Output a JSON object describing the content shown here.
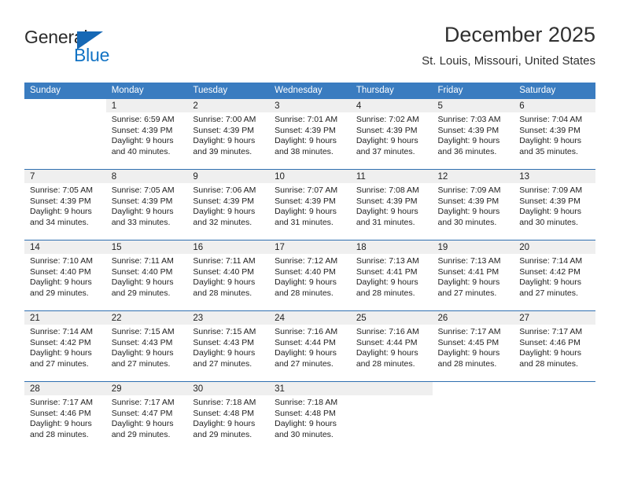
{
  "brand": {
    "name_line1": "General",
    "name_line2": "Blue",
    "accent_color": "#1668b5",
    "text_color": "#2b2b2b"
  },
  "header": {
    "title": "December 2025",
    "subtitle": "St. Louis, Missouri, United States"
  },
  "calendar": {
    "header_bg": "#3a7cc0",
    "daynum_bg": "#efefef",
    "separator_color": "#2f6fb0",
    "weekdays": [
      "Sunday",
      "Monday",
      "Tuesday",
      "Wednesday",
      "Thursday",
      "Friday",
      "Saturday"
    ],
    "weeks": [
      [
        {
          "day": "",
          "sunrise": "",
          "sunset": "",
          "daylight_line1": "",
          "daylight_line2": "",
          "blank": true
        },
        {
          "day": "1",
          "sunrise": "Sunrise: 6:59 AM",
          "sunset": "Sunset: 4:39 PM",
          "daylight_line1": "Daylight: 9 hours",
          "daylight_line2": "and 40 minutes."
        },
        {
          "day": "2",
          "sunrise": "Sunrise: 7:00 AM",
          "sunset": "Sunset: 4:39 PM",
          "daylight_line1": "Daylight: 9 hours",
          "daylight_line2": "and 39 minutes."
        },
        {
          "day": "3",
          "sunrise": "Sunrise: 7:01 AM",
          "sunset": "Sunset: 4:39 PM",
          "daylight_line1": "Daylight: 9 hours",
          "daylight_line2": "and 38 minutes."
        },
        {
          "day": "4",
          "sunrise": "Sunrise: 7:02 AM",
          "sunset": "Sunset: 4:39 PM",
          "daylight_line1": "Daylight: 9 hours",
          "daylight_line2": "and 37 minutes."
        },
        {
          "day": "5",
          "sunrise": "Sunrise: 7:03 AM",
          "sunset": "Sunset: 4:39 PM",
          "daylight_line1": "Daylight: 9 hours",
          "daylight_line2": "and 36 minutes."
        },
        {
          "day": "6",
          "sunrise": "Sunrise: 7:04 AM",
          "sunset": "Sunset: 4:39 PM",
          "daylight_line1": "Daylight: 9 hours",
          "daylight_line2": "and 35 minutes."
        }
      ],
      [
        {
          "day": "7",
          "sunrise": "Sunrise: 7:05 AM",
          "sunset": "Sunset: 4:39 PM",
          "daylight_line1": "Daylight: 9 hours",
          "daylight_line2": "and 34 minutes."
        },
        {
          "day": "8",
          "sunrise": "Sunrise: 7:05 AM",
          "sunset": "Sunset: 4:39 PM",
          "daylight_line1": "Daylight: 9 hours",
          "daylight_line2": "and 33 minutes."
        },
        {
          "day": "9",
          "sunrise": "Sunrise: 7:06 AM",
          "sunset": "Sunset: 4:39 PM",
          "daylight_line1": "Daylight: 9 hours",
          "daylight_line2": "and 32 minutes."
        },
        {
          "day": "10",
          "sunrise": "Sunrise: 7:07 AM",
          "sunset": "Sunset: 4:39 PM",
          "daylight_line1": "Daylight: 9 hours",
          "daylight_line2": "and 31 minutes."
        },
        {
          "day": "11",
          "sunrise": "Sunrise: 7:08 AM",
          "sunset": "Sunset: 4:39 PM",
          "daylight_line1": "Daylight: 9 hours",
          "daylight_line2": "and 31 minutes."
        },
        {
          "day": "12",
          "sunrise": "Sunrise: 7:09 AM",
          "sunset": "Sunset: 4:39 PM",
          "daylight_line1": "Daylight: 9 hours",
          "daylight_line2": "and 30 minutes."
        },
        {
          "day": "13",
          "sunrise": "Sunrise: 7:09 AM",
          "sunset": "Sunset: 4:39 PM",
          "daylight_line1": "Daylight: 9 hours",
          "daylight_line2": "and 30 minutes."
        }
      ],
      [
        {
          "day": "14",
          "sunrise": "Sunrise: 7:10 AM",
          "sunset": "Sunset: 4:40 PM",
          "daylight_line1": "Daylight: 9 hours",
          "daylight_line2": "and 29 minutes."
        },
        {
          "day": "15",
          "sunrise": "Sunrise: 7:11 AM",
          "sunset": "Sunset: 4:40 PM",
          "daylight_line1": "Daylight: 9 hours",
          "daylight_line2": "and 29 minutes."
        },
        {
          "day": "16",
          "sunrise": "Sunrise: 7:11 AM",
          "sunset": "Sunset: 4:40 PM",
          "daylight_line1": "Daylight: 9 hours",
          "daylight_line2": "and 28 minutes."
        },
        {
          "day": "17",
          "sunrise": "Sunrise: 7:12 AM",
          "sunset": "Sunset: 4:40 PM",
          "daylight_line1": "Daylight: 9 hours",
          "daylight_line2": "and 28 minutes."
        },
        {
          "day": "18",
          "sunrise": "Sunrise: 7:13 AM",
          "sunset": "Sunset: 4:41 PM",
          "daylight_line1": "Daylight: 9 hours",
          "daylight_line2": "and 28 minutes."
        },
        {
          "day": "19",
          "sunrise": "Sunrise: 7:13 AM",
          "sunset": "Sunset: 4:41 PM",
          "daylight_line1": "Daylight: 9 hours",
          "daylight_line2": "and 27 minutes."
        },
        {
          "day": "20",
          "sunrise": "Sunrise: 7:14 AM",
          "sunset": "Sunset: 4:42 PM",
          "daylight_line1": "Daylight: 9 hours",
          "daylight_line2": "and 27 minutes."
        }
      ],
      [
        {
          "day": "21",
          "sunrise": "Sunrise: 7:14 AM",
          "sunset": "Sunset: 4:42 PM",
          "daylight_line1": "Daylight: 9 hours",
          "daylight_line2": "and 27 minutes."
        },
        {
          "day": "22",
          "sunrise": "Sunrise: 7:15 AM",
          "sunset": "Sunset: 4:43 PM",
          "daylight_line1": "Daylight: 9 hours",
          "daylight_line2": "and 27 minutes."
        },
        {
          "day": "23",
          "sunrise": "Sunrise: 7:15 AM",
          "sunset": "Sunset: 4:43 PM",
          "daylight_line1": "Daylight: 9 hours",
          "daylight_line2": "and 27 minutes."
        },
        {
          "day": "24",
          "sunrise": "Sunrise: 7:16 AM",
          "sunset": "Sunset: 4:44 PM",
          "daylight_line1": "Daylight: 9 hours",
          "daylight_line2": "and 27 minutes."
        },
        {
          "day": "25",
          "sunrise": "Sunrise: 7:16 AM",
          "sunset": "Sunset: 4:44 PM",
          "daylight_line1": "Daylight: 9 hours",
          "daylight_line2": "and 28 minutes."
        },
        {
          "day": "26",
          "sunrise": "Sunrise: 7:17 AM",
          "sunset": "Sunset: 4:45 PM",
          "daylight_line1": "Daylight: 9 hours",
          "daylight_line2": "and 28 minutes."
        },
        {
          "day": "27",
          "sunrise": "Sunrise: 7:17 AM",
          "sunset": "Sunset: 4:46 PM",
          "daylight_line1": "Daylight: 9 hours",
          "daylight_line2": "and 28 minutes."
        }
      ],
      [
        {
          "day": "28",
          "sunrise": "Sunrise: 7:17 AM",
          "sunset": "Sunset: 4:46 PM",
          "daylight_line1": "Daylight: 9 hours",
          "daylight_line2": "and 28 minutes."
        },
        {
          "day": "29",
          "sunrise": "Sunrise: 7:17 AM",
          "sunset": "Sunset: 4:47 PM",
          "daylight_line1": "Daylight: 9 hours",
          "daylight_line2": "and 29 minutes."
        },
        {
          "day": "30",
          "sunrise": "Sunrise: 7:18 AM",
          "sunset": "Sunset: 4:48 PM",
          "daylight_line1": "Daylight: 9 hours",
          "daylight_line2": "and 29 minutes."
        },
        {
          "day": "31",
          "sunrise": "Sunrise: 7:18 AM",
          "sunset": "Sunset: 4:48 PM",
          "daylight_line1": "Daylight: 9 hours",
          "daylight_line2": "and 30 minutes."
        },
        {
          "day": "",
          "sunrise": "",
          "sunset": "",
          "daylight_line1": "",
          "daylight_line2": "",
          "trailing": true
        },
        {
          "day": "",
          "sunrise": "",
          "sunset": "",
          "daylight_line1": "",
          "daylight_line2": "",
          "blank": true
        },
        {
          "day": "",
          "sunrise": "",
          "sunset": "",
          "daylight_line1": "",
          "daylight_line2": "",
          "blank": true
        }
      ]
    ]
  }
}
